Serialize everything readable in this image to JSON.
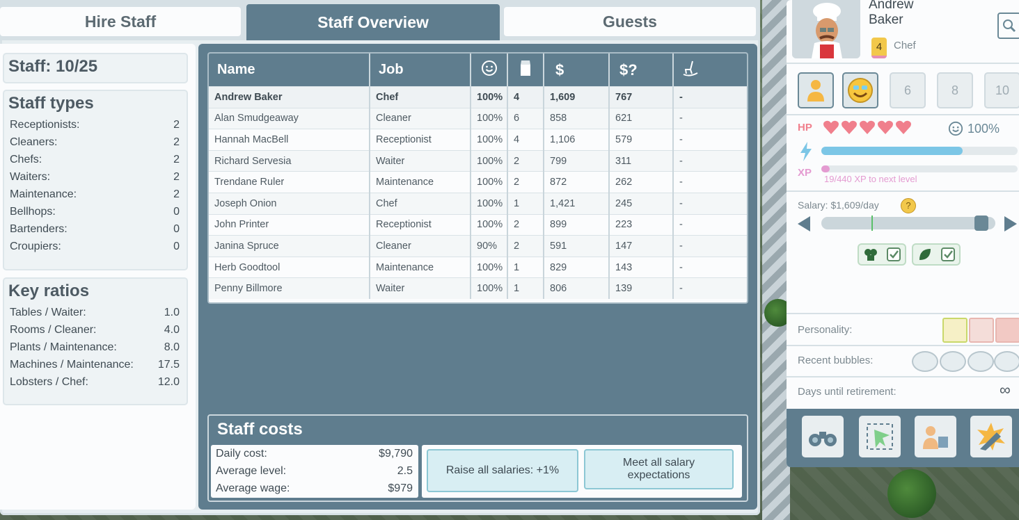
{
  "tabs": [
    {
      "label": "Hire Staff",
      "active": false
    },
    {
      "label": "Staff Overview",
      "active": true
    },
    {
      "label": "Guests",
      "active": false
    }
  ],
  "staff_count": "Staff: 10/25",
  "staff_types": {
    "title": "Staff types",
    "rows": [
      {
        "label": "Receptionists:",
        "value": "2"
      },
      {
        "label": "Cleaners:",
        "value": "2"
      },
      {
        "label": "Chefs:",
        "value": "2"
      },
      {
        "label": "Waiters:",
        "value": "2"
      },
      {
        "label": "Maintenance:",
        "value": "2"
      },
      {
        "label": "Bellhops:",
        "value": "0"
      },
      {
        "label": "Bartenders:",
        "value": "0"
      },
      {
        "label": "Croupiers:",
        "value": "0"
      }
    ]
  },
  "key_ratios": {
    "title": "Key ratios",
    "rows": [
      {
        "label": "Tables / Waiter:",
        "value": "1.0"
      },
      {
        "label": "Rooms / Cleaner:",
        "value": "4.0"
      },
      {
        "label": "Plants / Maintenance:",
        "value": "8.0"
      },
      {
        "label": "Machines / Maintenance:",
        "value": "17.5"
      },
      {
        "label": "Lobsters / Chef:",
        "value": "12.0"
      }
    ]
  },
  "table": {
    "headers": {
      "name": "Name",
      "job": "Job",
      "happiness_icon": "smiley-icon",
      "level_icon": "level-icon",
      "salary": "$",
      "expected_salary": "$?",
      "retire_icon": "rocking-chair-icon"
    },
    "rows": [
      {
        "name": "Andrew Baker",
        "job": "Chef",
        "happy": "100%",
        "level": "4",
        "salary": "1,609",
        "expected": "767",
        "retire": "-"
      },
      {
        "name": "Alan Smudgeaway",
        "job": "Cleaner",
        "happy": "100%",
        "level": "6",
        "salary": "858",
        "expected": "621",
        "retire": "-"
      },
      {
        "name": "Hannah MacBell",
        "job": "Receptionist",
        "happy": "100%",
        "level": "4",
        "salary": "1,106",
        "expected": "579",
        "retire": "-"
      },
      {
        "name": "Richard Servesia",
        "job": "Waiter",
        "happy": "100%",
        "level": "2",
        "salary": "799",
        "expected": "311",
        "retire": "-"
      },
      {
        "name": "Trendane Ruler",
        "job": "Maintenance",
        "happy": "100%",
        "level": "2",
        "salary": "872",
        "expected": "262",
        "retire": "-"
      },
      {
        "name": "Joseph Onion",
        "job": "Chef",
        "happy": "100%",
        "level": "1",
        "salary": "1,421",
        "expected": "245",
        "retire": "-"
      },
      {
        "name": "John Printer",
        "job": "Receptionist",
        "happy": "100%",
        "level": "2",
        "salary": "899",
        "expected": "223",
        "retire": "-"
      },
      {
        "name": "Janina Spruce",
        "job": "Cleaner",
        "happy": "90%",
        "level": "2",
        "salary": "591",
        "expected": "147",
        "retire": "-"
      },
      {
        "name": "Herb Goodtool",
        "job": "Maintenance",
        "happy": "100%",
        "level": "1",
        "salary": "829",
        "expected": "143",
        "retire": "-"
      },
      {
        "name": "Penny Billmore",
        "job": "Waiter",
        "happy": "100%",
        "level": "1",
        "salary": "806",
        "expected": "139",
        "retire": "-"
      }
    ]
  },
  "staff_costs": {
    "title": "Staff costs",
    "daily_label": "Daily cost:",
    "daily_value": "$9,790",
    "avglevel_label": "Average level:",
    "avglevel_value": "2.5",
    "avgwage_label": "Average wage:",
    "avgwage_value": "$979",
    "raise_button": "Raise all salaries: +1%",
    "meet_button": "Meet all salary expectations"
  },
  "profile": {
    "first_name": "Andrew",
    "last_name": "Baker",
    "level": "4",
    "role": "Chef",
    "skills": [
      "6",
      "8",
      "10"
    ],
    "happiness": "100%",
    "hp_hearts": 5,
    "energy_fill": 0.72,
    "xp_text": "19/440 XP to next level",
    "xp_fill": 0.043,
    "salary_text": "Salary: $1,609/day",
    "salary_fill": 0.92,
    "personality_label": "Personality:",
    "bubbles_label": "Recent bubbles:",
    "retirement_label": "Days until retirement:",
    "retirement_value": "∞",
    "colors": {
      "panel": "#5f7d8e",
      "energy": "#7cc6e6",
      "xp": "#e49bd1",
      "hearts": "#f07f8c",
      "accent": "#8cc7d4"
    }
  }
}
